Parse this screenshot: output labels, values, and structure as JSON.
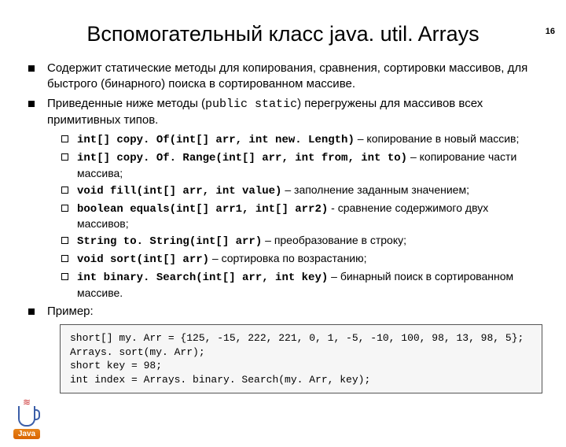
{
  "page_number": "16",
  "title": "Вспомогательный класс java. util. Arrays",
  "bullets": [
    {
      "text": "Содержит статические методы для копирования, сравнения, сортировки массивов, для быстрого (бинарного) поиска в сортированном массиве."
    },
    {
      "prefix": "Приведенные ниже методы (",
      "code_inline": "public static",
      "suffix": ") перегружены для массивов всех примитивных типов."
    }
  ],
  "methods": [
    {
      "sig": "int[] copy. Of(int[] arr, int new. Length)",
      "desc": " – копирование в новый массив;"
    },
    {
      "sig": "int[] copy. Of. Range(int[] arr, int from, int to)",
      "desc": " – копирование части массива;"
    },
    {
      "sig": "void fill(int[] arr, int value)",
      "desc": " – заполнение заданным значением;"
    },
    {
      "sig": "boolean equals(int[] arr1, int[] arr2)",
      "desc": " - сравнение содержимого двух массивов;"
    },
    {
      "sig": "String to. String(int[] arr)",
      "desc": " – преобразование в строку;"
    },
    {
      "sig": "void sort(int[] arr)",
      "desc": " – сортировка по возрастанию;"
    },
    {
      "sig": "int binary. Search(int[] arr, int key)",
      "desc": " – бинарный поиск в сортированном массиве."
    }
  ],
  "example_label": "Пример:",
  "code": "short[] my. Arr = {125, -15, 222, 221, 0, 1, -5, -10, 100, 98, 13, 98, 5};\nArrays. sort(my. Arr);\nshort key = 98;\nint index = Arrays. binary. Search(my. Arr, key);",
  "logo_text": "Java"
}
